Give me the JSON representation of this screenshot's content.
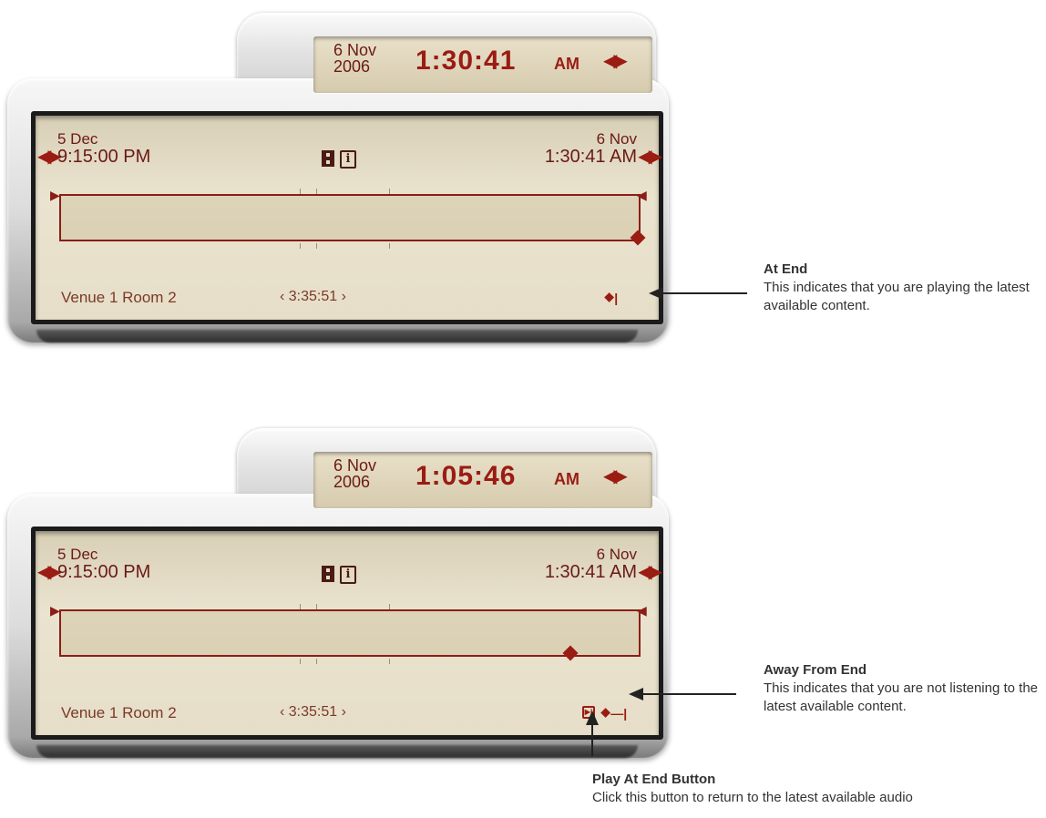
{
  "widgets": [
    {
      "clock": {
        "date": "6 Nov\n2006",
        "time": "1:30:41",
        "ampm": "AM",
        "nav_icon": "left-right-arrows"
      },
      "range": {
        "start_date": "5 Dec",
        "start_time": "9:15:00 PM",
        "end_date": "6 Nov",
        "end_time": "1:30:41 AM"
      },
      "venue": "Venue 1 Room 2",
      "duration": "‹ 3:35:51 ›",
      "playhead_fraction": 1.0,
      "status": {
        "label": "⯁|",
        "icon": "at-end-icon"
      }
    },
    {
      "clock": {
        "date": "6 Nov\n2006",
        "time": "1:05:46",
        "ampm": "AM",
        "nav_icon": "left-right-arrows"
      },
      "range": {
        "start_date": "5 Dec",
        "start_time": "9:15:00 PM",
        "end_date": "6 Nov",
        "end_time": "1:30:41 AM"
      },
      "venue": "Venue 1 Room 2",
      "duration": "‹ 3:35:51 ›",
      "playhead_fraction": 0.884,
      "status": {
        "label": "⯁—|",
        "icon": "away-from-end-icon",
        "button_glyph": "▶|"
      }
    }
  ],
  "annotations": {
    "at_end": {
      "title": "At End",
      "text": "This indicates that you are playing the latest available content."
    },
    "away_from_end": {
      "title": "Away From End",
      "text": "This indicates that you are not listening to the latest available content."
    },
    "play_at_end": {
      "title": "Play At End Button",
      "text": "Click this button to return to the latest available audio"
    }
  },
  "colors": {
    "accent": "#9a1c12",
    "screen": "#e6dec8",
    "text": "#6b1a14"
  }
}
